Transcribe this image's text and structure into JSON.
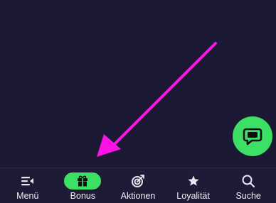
{
  "colors": {
    "background": "#1b1833",
    "nav_background": "#1e1b36",
    "accent_green": "#3be064",
    "annotation_arrow": "#ff12e6",
    "nav_text": "#f1f1f4",
    "icon_light": "#e6e6ec"
  },
  "chat_button": {
    "icon": "chat-bubble-icon"
  },
  "nav": {
    "active_index": 1,
    "items": [
      {
        "label": "Menü",
        "icon": "menu-icon"
      },
      {
        "label": "Bonus",
        "icon": "gift-icon"
      },
      {
        "label": "Aktionen",
        "icon": "target-icon"
      },
      {
        "label": "Loyalität",
        "icon": "star-icon"
      },
      {
        "label": "Suche",
        "icon": "search-icon"
      }
    ]
  }
}
